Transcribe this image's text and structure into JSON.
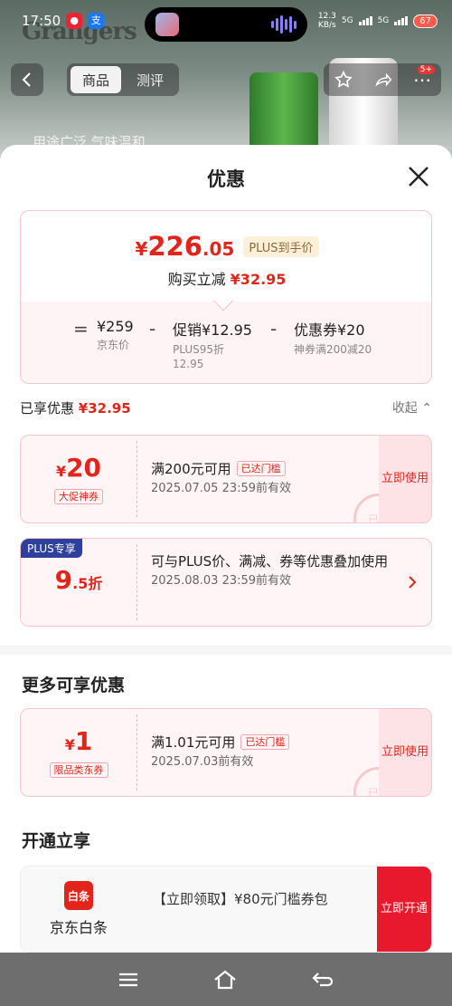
{
  "status_bar": {
    "time": "17:50",
    "net_speed_value": "12.3",
    "net_speed_unit": "KB/s",
    "signal_1": "5G",
    "signal_2": "5G",
    "battery": "67"
  },
  "background": {
    "brand": "Grangers",
    "peek_text": "用途广泛 气味温和"
  },
  "top_nav": {
    "tabs": [
      "商品",
      "测评"
    ],
    "badge_count": "5+"
  },
  "sheet": {
    "title": "优惠",
    "price": {
      "currency": "¥",
      "integer": "226",
      "decimal": ".05",
      "plus_tag": "PLUS到手价",
      "buy_label": "购买立减",
      "buy_amount": "¥32.95"
    },
    "formula": {
      "eq": "=",
      "minus": "-",
      "items": [
        {
          "value": "¥259",
          "sub1": "京东价",
          "sub2": ""
        },
        {
          "value": "促销¥12.95",
          "sub1": "PLUS95折",
          "sub2": "12.95"
        },
        {
          "value": "优惠券¥20",
          "sub1": "神券满200减20",
          "sub2": ""
        }
      ]
    },
    "enjoyed": {
      "label": "已享优惠",
      "amount": "¥32.95",
      "collapse": "收起"
    },
    "coupon1": {
      "cur": "¥",
      "amount": "20",
      "tag": "大促神券",
      "cond": "满200元可用",
      "status": "已达门槛",
      "date": "2025.07.05 23:59前有效",
      "action": "立即使用",
      "stamp": "已领"
    },
    "coupon2": {
      "corner": "PLUS专享",
      "amount": "9",
      "amount_sub": ".5折",
      "desc": "可与PLUS价、满减、券等优惠叠加使用",
      "date": "2025.08.03 23:59前有效"
    },
    "more_title": "更多可享优惠",
    "coupon3": {
      "cur": "¥",
      "amount": "1",
      "tag": "限品类东券",
      "cond": "满1.01元可用",
      "status": "已达门槛",
      "date": "2025.07.03前有效",
      "action": "立即使用",
      "stamp": "已领"
    },
    "open_title": "开通立享",
    "baitiao": {
      "logo": "白条",
      "name": "京东白条",
      "desc": "【立即领取】¥80元门槛券包",
      "action": "立即开通"
    }
  },
  "colors": {
    "accent": "#e1251b",
    "plus": "#2e3f9c"
  }
}
